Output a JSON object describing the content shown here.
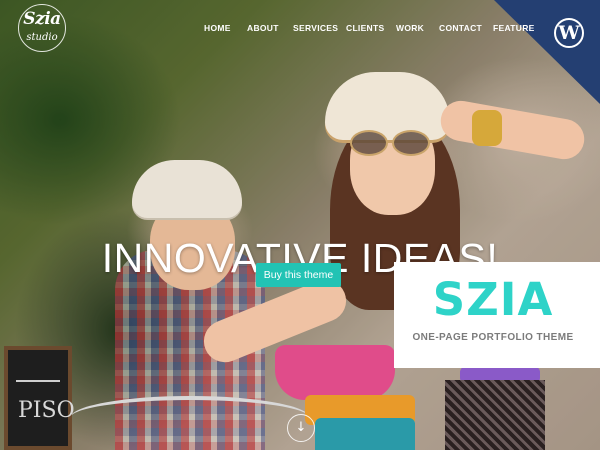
{
  "logo": {
    "line1": "Szia",
    "line2": "studio"
  },
  "nav": {
    "items": [
      "HOME",
      "ABOUT",
      "SERVICES",
      "CLIENTS",
      "WORK",
      "CONTACT",
      "FEATURE"
    ]
  },
  "hero": {
    "headline": "INNOVATIVE IDEAS!",
    "cta_label": "Buy this theme",
    "chalkboard_text": "PISO"
  },
  "promo": {
    "brand": "SZIA",
    "tagline": "ONE-PAGE PORTFOLIO THEME"
  },
  "wordpress": {
    "glyph": "W"
  },
  "scroll": {
    "glyph": "↓"
  },
  "colors": {
    "accent": "#22c3b4",
    "brand": "#2ed3c8",
    "ribbon": "#243f72"
  }
}
